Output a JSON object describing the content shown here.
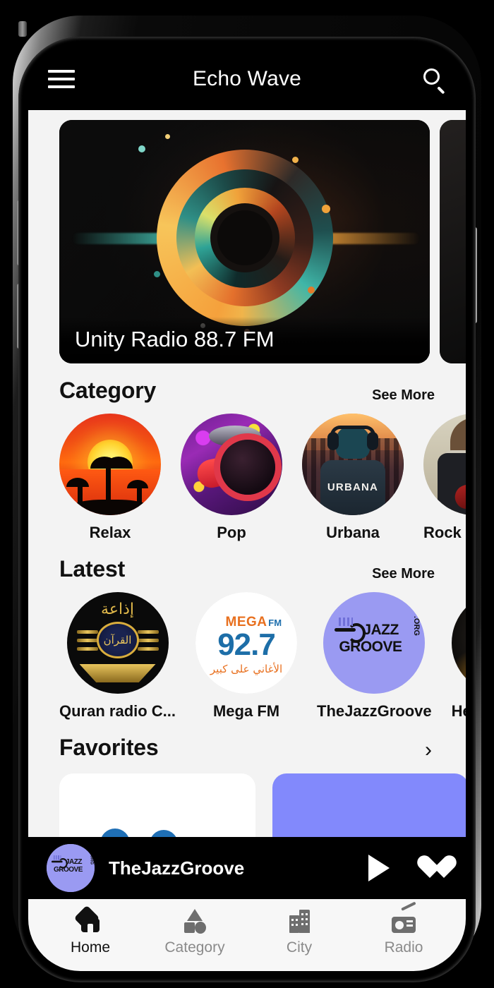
{
  "app": {
    "title": "Echo Wave",
    "menu_icon": "hamburger-menu-icon",
    "search_icon": "search-icon"
  },
  "banner": {
    "caption": "Unity Radio 88.7 FM",
    "artwork": "audio-wave-vinyl-artwork"
  },
  "category_section": {
    "title": "Category",
    "see_more": "See More",
    "items": [
      {
        "label": "Relax",
        "artwork": "sunset-palm-trees"
      },
      {
        "label": "Pop",
        "artwork": "purple-dj-headphones"
      },
      {
        "label": "Urbana",
        "artwork": "city-person-headphones"
      },
      {
        "label": "Rock",
        "artwork": "guitarist-red-guitar"
      }
    ]
  },
  "latest_section": {
    "title": "Latest",
    "see_more": "See More",
    "items": [
      {
        "label": "Quran radio C...",
        "artwork": "quran-gold-emblem-black"
      },
      {
        "label": "Mega FM",
        "artwork": "mega-fm-927-logo",
        "logo_text": "MEGA",
        "logo_fm": "FM",
        "logo_number": "92.7",
        "logo_arabic": "الأغاني على كبير"
      },
      {
        "label": "TheJazzGroove",
        "artwork": "jazz-groove-trumpet-logo",
        "logo_line1": "JAZZ",
        "logo_line2": "GROOVE",
        "logo_org": ".ORG"
      },
      {
        "label": "Heartbe",
        "artwork": "yellow-headphones-smoke"
      }
    ]
  },
  "favorites_section": {
    "title": "Favorites",
    "chevron": "chevron-right-icon",
    "cards": [
      {
        "style": "white"
      },
      {
        "style": "purple"
      }
    ]
  },
  "player": {
    "station": "TheJazzGroove",
    "play_icon": "play-icon",
    "favorite_icon": "heart-filled-icon"
  },
  "bottom_nav": {
    "items": [
      {
        "label": "Home",
        "icon": "home-icon",
        "active": true
      },
      {
        "label": "Category",
        "icon": "shapes-icon",
        "active": false
      },
      {
        "label": "City",
        "icon": "buildings-icon",
        "active": false
      },
      {
        "label": "Radio",
        "icon": "radio-icon",
        "active": false
      }
    ]
  },
  "quran_arabic_top": "إذاعة",
  "quran_arabic_emblem": "القرآن",
  "colors": {
    "accent_purple": "#8289fc",
    "jazz_circle": "#9a9af2",
    "appbar_bg": "#000000",
    "page_bg": "#f3f3f3",
    "navbar_bg": "#f7f7f7",
    "nav_active": "#111111",
    "nav_inactive": "#8a8a8a"
  }
}
